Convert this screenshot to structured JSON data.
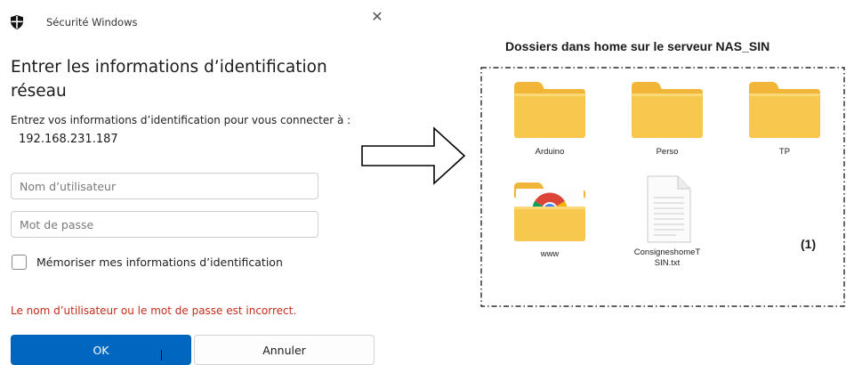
{
  "dialog": {
    "app_title": "Sécurité Windows",
    "heading": "Entrer les informations d’identification réseau",
    "prompt": "Entrez vos informations d’identification pour vous connecter à :",
    "host": "192.168.231.187",
    "username_placeholder": "Nom d’utilisateur",
    "password_placeholder": "Mot de passe",
    "remember_label": "Mémoriser mes informations d’identification",
    "remember_checked": false,
    "error_message": "Le nom d’utilisateur ou le mot de passe est incorrect.",
    "ok_label": "OK",
    "cancel_label": "Annuler",
    "close_glyph": "✕",
    "accent_color": "#0067c0",
    "error_color": "#c42b1c"
  },
  "explorer": {
    "title": "Dossiers dans home sur le serveur NAS_SIN",
    "items": [
      {
        "label": "Arduino",
        "icon": "folder-icon"
      },
      {
        "label": "Perso",
        "icon": "folder-icon"
      },
      {
        "label": "TP",
        "icon": "folder-icon"
      },
      {
        "label": "www",
        "icon": "chrome-folder-icon"
      },
      {
        "label": "ConsigneshomeT SIN.txt",
        "label_line1": "ConsigneshomeT",
        "label_line2": "SIN.txt",
        "icon": "text-file-icon"
      }
    ],
    "badge": "(1)",
    "folder_color": "#f8c74e"
  }
}
